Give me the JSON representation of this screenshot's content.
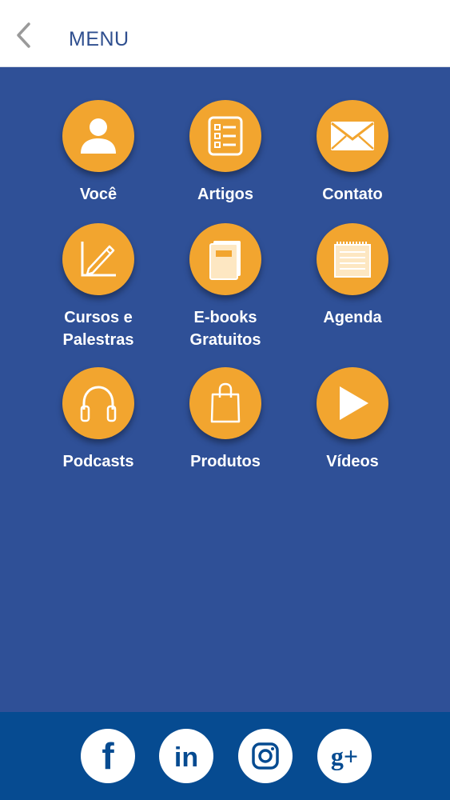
{
  "header": {
    "title": "MENU",
    "back_icon": "chevron-left-icon"
  },
  "menu": {
    "items": [
      {
        "label": "Você",
        "icon": "person-icon"
      },
      {
        "label": "Artigos",
        "icon": "checklist-icon"
      },
      {
        "label": "Contato",
        "icon": "envelope-icon"
      },
      {
        "label": "Cursos e\nPalestras",
        "icon": "pencil-chart-icon"
      },
      {
        "label": "E-books\nGratuitos",
        "icon": "book-icon"
      },
      {
        "label": "Agenda",
        "icon": "notepad-icon"
      },
      {
        "label": "Podcasts",
        "icon": "headphones-icon"
      },
      {
        "label": "Produtos",
        "icon": "shopping-bag-icon"
      },
      {
        "label": "Vídeos",
        "icon": "play-icon"
      }
    ]
  },
  "footer": {
    "social": [
      {
        "name": "facebook",
        "icon": "facebook-icon"
      },
      {
        "name": "linkedin",
        "icon": "linkedin-icon"
      },
      {
        "name": "instagram",
        "icon": "instagram-icon"
      },
      {
        "name": "google-plus",
        "icon": "google-plus-icon"
      }
    ]
  },
  "colors": {
    "background": "#2f5097",
    "accent": "#f2a52f",
    "footer": "#064b91",
    "header_text": "#2f4f8f"
  }
}
